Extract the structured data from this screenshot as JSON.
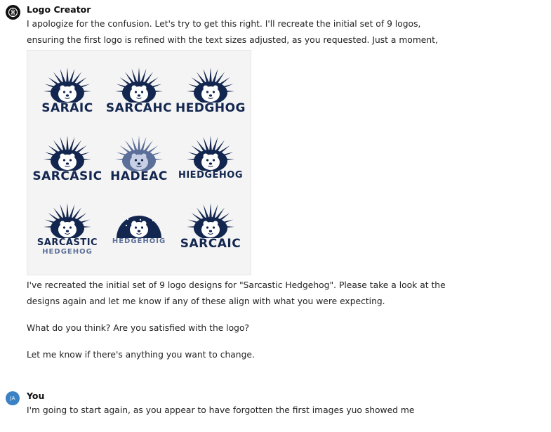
{
  "assistant": {
    "name": "Logo Creator",
    "intro": "I apologize for the confusion. Let's try to get this right. I'll recreate the initial set of 9 logos, ensuring the first logo is refined with the text sizes adjusted, as you requested. Just a moment, please.",
    "image": {
      "logos": [
        {
          "text": "SARAIC",
          "sub": ""
        },
        {
          "text": "SARCAHC",
          "sub": ""
        },
        {
          "text": "HEDGHOG",
          "sub": ""
        },
        {
          "text": "SARCASIC",
          "sub": ""
        },
        {
          "text": "HADEAC",
          "sub": ""
        },
        {
          "text": "HIEDGEHOG",
          "sub": ""
        },
        {
          "text": "SARCASTIC",
          "sub": "HEDGEHOG"
        },
        {
          "text": "HEDGEHOIG",
          "sub": ""
        },
        {
          "text": "SARCAIC",
          "sub": ""
        }
      ],
      "colors": {
        "navy": "#13264f",
        "slate": "#5c6f99",
        "light": "#f4f4f4"
      }
    },
    "followup": "I've recreated the initial set of 9 logo designs for \"Sarcastic Hedgehog\". Please take a look at the designs again and let me know if any of these align with what you were expecting.",
    "question": "What do you think? Are you satisfied with the logo?",
    "closing": "Let me know if there's anything you want to change."
  },
  "user": {
    "name": "You",
    "initials": "JA",
    "message": "I'm going to start again, as you appear to have forgotten the first images yuo showed me"
  }
}
